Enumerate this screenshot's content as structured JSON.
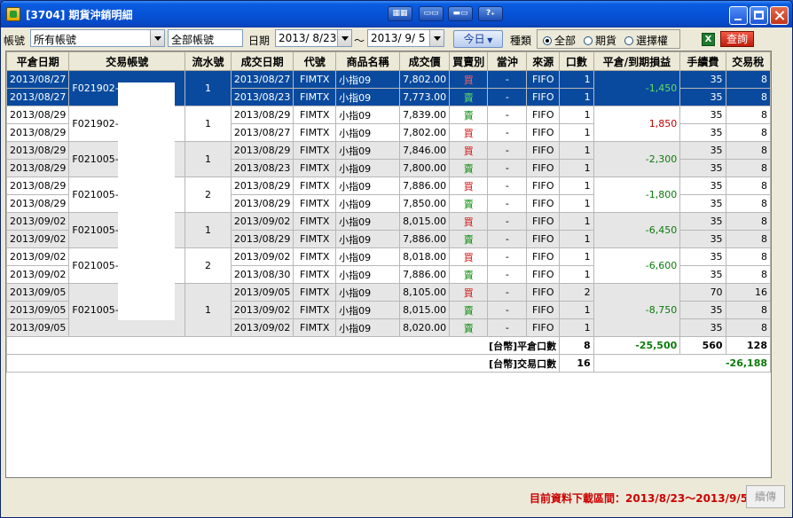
{
  "window": {
    "title": "[3704] 期貨沖銷明細",
    "toolbar_icons": [
      "layout-icon",
      "window-icon",
      "minimize-panel-icon",
      "help-icon"
    ]
  },
  "filters": {
    "account_label": "帳號",
    "account_value": "所有帳號",
    "account_name": "全部帳號",
    "date_label": "日期",
    "date_from": "2013/ 8/23",
    "date_sep": "～",
    "date_to": "2013/ 9/ 5",
    "today_button": "今日",
    "type_label": "種類",
    "type_options": [
      "全部",
      "期貨",
      "選擇權"
    ],
    "type_selected": "全部",
    "query_button": "查詢"
  },
  "table": {
    "columns": [
      "平倉日期",
      "交易帳號",
      "流水號",
      "成交日期",
      "代號",
      "商品名稱",
      "成交價",
      "買賣別",
      "當沖",
      "來源",
      "口數",
      "平倉/到期損益",
      "手續費",
      "交易稅"
    ],
    "groups": [
      {
        "account": "F021902-",
        "serial": "1",
        "pnl": "-1,450",
        "pnl_sign": "neg",
        "selected": true,
        "rows": [
          {
            "close_date": "2013/08/27",
            "trade_date": "2013/08/27",
            "code": "FIMTX",
            "product": "小指09",
            "price": "7,802.00",
            "side": "買",
            "daytrade": "-",
            "source": "FIFO",
            "qty": "1",
            "fee": "35",
            "tax": "8"
          },
          {
            "close_date": "2013/08/27",
            "trade_date": "2013/08/23",
            "code": "FIMTX",
            "product": "小指09",
            "price": "7,773.00",
            "side": "賣",
            "daytrade": "-",
            "source": "FIFO",
            "qty": "1",
            "fee": "35",
            "tax": "8"
          }
        ]
      },
      {
        "account": "F021902-",
        "serial": "1",
        "pnl": "1,850",
        "pnl_sign": "pos",
        "selected": false,
        "rows": [
          {
            "close_date": "2013/08/29",
            "trade_date": "2013/08/29",
            "code": "FIMTX",
            "product": "小指09",
            "price": "7,839.00",
            "side": "賣",
            "daytrade": "-",
            "source": "FIFO",
            "qty": "1",
            "fee": "35",
            "tax": "8"
          },
          {
            "close_date": "2013/08/29",
            "trade_date": "2013/08/27",
            "code": "FIMTX",
            "product": "小指09",
            "price": "7,802.00",
            "side": "買",
            "daytrade": "-",
            "source": "FIFO",
            "qty": "1",
            "fee": "35",
            "tax": "8"
          }
        ]
      },
      {
        "account": "F021005-",
        "serial": "1",
        "pnl": "-2,300",
        "pnl_sign": "neg",
        "selected": false,
        "rows": [
          {
            "close_date": "2013/08/29",
            "trade_date": "2013/08/29",
            "code": "FIMTX",
            "product": "小指09",
            "price": "7,846.00",
            "side": "買",
            "daytrade": "-",
            "source": "FIFO",
            "qty": "1",
            "fee": "35",
            "tax": "8"
          },
          {
            "close_date": "2013/08/29",
            "trade_date": "2013/08/23",
            "code": "FIMTX",
            "product": "小指09",
            "price": "7,800.00",
            "side": "賣",
            "daytrade": "-",
            "source": "FIFO",
            "qty": "1",
            "fee": "35",
            "tax": "8"
          }
        ]
      },
      {
        "account": "F021005-",
        "serial": "2",
        "pnl": "-1,800",
        "pnl_sign": "neg",
        "selected": false,
        "rows": [
          {
            "close_date": "2013/08/29",
            "trade_date": "2013/08/29",
            "code": "FIMTX",
            "product": "小指09",
            "price": "7,886.00",
            "side": "買",
            "daytrade": "-",
            "source": "FIFO",
            "qty": "1",
            "fee": "35",
            "tax": "8"
          },
          {
            "close_date": "2013/08/29",
            "trade_date": "2013/08/29",
            "code": "FIMTX",
            "product": "小指09",
            "price": "7,850.00",
            "side": "賣",
            "daytrade": "-",
            "source": "FIFO",
            "qty": "1",
            "fee": "35",
            "tax": "8"
          }
        ]
      },
      {
        "account": "F021005-",
        "serial": "1",
        "pnl": "-6,450",
        "pnl_sign": "neg",
        "selected": false,
        "rows": [
          {
            "close_date": "2013/09/02",
            "trade_date": "2013/09/02",
            "code": "FIMTX",
            "product": "小指09",
            "price": "8,015.00",
            "side": "買",
            "daytrade": "-",
            "source": "FIFO",
            "qty": "1",
            "fee": "35",
            "tax": "8"
          },
          {
            "close_date": "2013/09/02",
            "trade_date": "2013/08/29",
            "code": "FIMTX",
            "product": "小指09",
            "price": "7,886.00",
            "side": "賣",
            "daytrade": "-",
            "source": "FIFO",
            "qty": "1",
            "fee": "35",
            "tax": "8"
          }
        ]
      },
      {
        "account": "F021005-",
        "serial": "2",
        "pnl": "-6,600",
        "pnl_sign": "neg",
        "selected": false,
        "rows": [
          {
            "close_date": "2013/09/02",
            "trade_date": "2013/09/02",
            "code": "FIMTX",
            "product": "小指09",
            "price": "8,018.00",
            "side": "買",
            "daytrade": "-",
            "source": "FIFO",
            "qty": "1",
            "fee": "35",
            "tax": "8"
          },
          {
            "close_date": "2013/09/02",
            "trade_date": "2013/08/30",
            "code": "FIMTX",
            "product": "小指09",
            "price": "7,886.00",
            "side": "賣",
            "daytrade": "-",
            "source": "FIFO",
            "qty": "1",
            "fee": "35",
            "tax": "8"
          }
        ]
      },
      {
        "account": "F021005-",
        "serial": "1",
        "pnl": "-8,750",
        "pnl_sign": "neg",
        "selected": false,
        "rows": [
          {
            "close_date": "2013/09/05",
            "trade_date": "2013/09/05",
            "code": "FIMTX",
            "product": "小指09",
            "price": "8,105.00",
            "side": "買",
            "daytrade": "-",
            "source": "FIFO",
            "qty": "2",
            "fee": "70",
            "tax": "16"
          },
          {
            "close_date": "2013/09/05",
            "trade_date": "2013/09/02",
            "code": "FIMTX",
            "product": "小指09",
            "price": "8,015.00",
            "side": "賣",
            "daytrade": "-",
            "source": "FIFO",
            "qty": "1",
            "fee": "35",
            "tax": "8"
          },
          {
            "close_date": "2013/09/05",
            "trade_date": "2013/09/02",
            "code": "FIMTX",
            "product": "小指09",
            "price": "8,020.00",
            "side": "賣",
            "daytrade": "-",
            "source": "FIFO",
            "qty": "1",
            "fee": "35",
            "tax": "8"
          }
        ]
      }
    ],
    "summary": {
      "close_label": "[台幣]平倉口數",
      "close_qty": "8",
      "close_pnl": "-25,500",
      "close_fee": "560",
      "close_tax": "128",
      "trade_label": "[台幣]交易口數",
      "trade_qty": "16",
      "net_total": "-26,188"
    }
  },
  "status": {
    "range_text": "目前資料下載區間：2013/8/23～2013/9/5",
    "continue_button": "續傳"
  },
  "colors": {
    "selected_row": "#0a4a9e",
    "buy": "#d01010",
    "sell": "#0a8a0a",
    "status_text": "#cc0000"
  }
}
